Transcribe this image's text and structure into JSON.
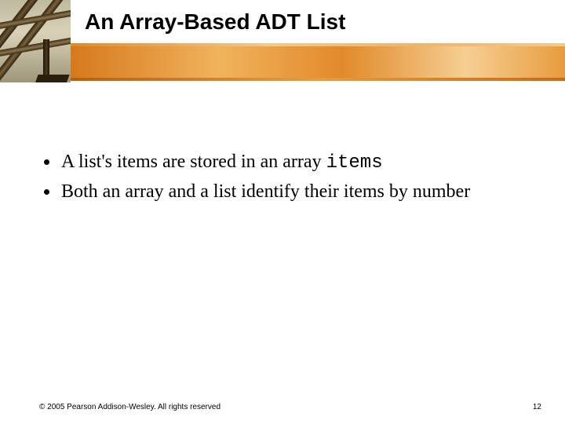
{
  "slide": {
    "title": "An Array-Based ADT List",
    "bullets": [
      {
        "pre": "A list's items are stored in an array ",
        "code": "items",
        "post": ""
      },
      {
        "pre": "Both an array and a list identify their items by number",
        "code": "",
        "post": ""
      }
    ],
    "footer": {
      "copyright": "© 2005 Pearson Addison-Wesley. All rights reserved",
      "page": "12"
    }
  }
}
